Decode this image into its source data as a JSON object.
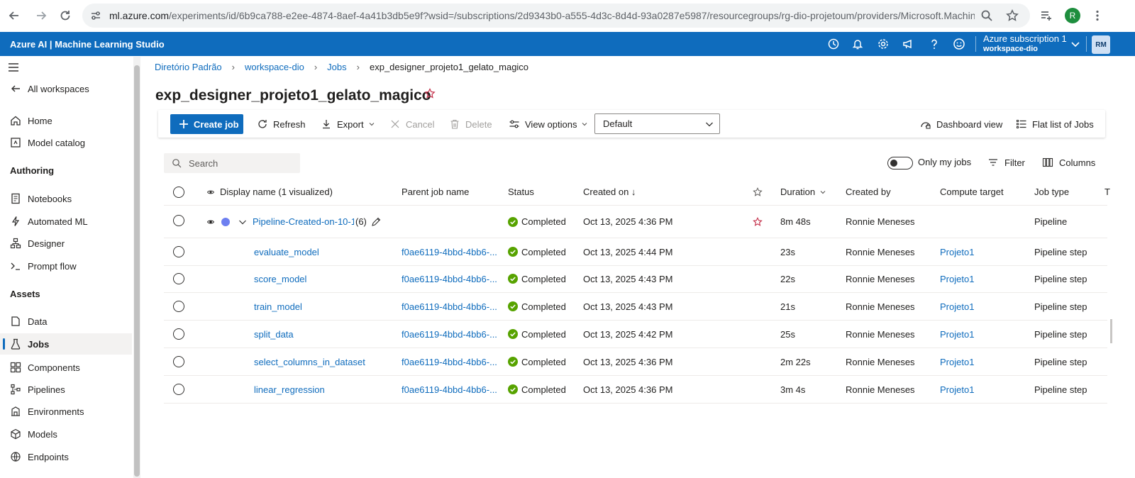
{
  "browser": {
    "url_main": "ml.azure.com",
    "url_rest": "/experiments/id/6b9ca788-e2ee-4874-8aef-4a41b3db5e9f?wsid=/subscriptions/2d9343b0-a555-4d3c-8d4d-93a0287e5987/resourcegroups/rg-dio-projetoum/providers/Microsoft.Machin...",
    "profile_initial": "R"
  },
  "header": {
    "app_title": "Azure AI | Machine Learning Studio",
    "subscription": "Azure subscription 1",
    "workspace": "workspace-dio",
    "avatar_initials": "RM"
  },
  "sidebar": {
    "all_workspaces": "All workspaces",
    "items_top": [
      {
        "label": "Home",
        "icon": "home-icon"
      },
      {
        "label": "Model catalog",
        "icon": "model-catalog-icon"
      }
    ],
    "section_authoring": "Authoring",
    "items_authoring": [
      {
        "label": "Notebooks",
        "icon": "notebook-icon"
      },
      {
        "label": "Automated ML",
        "icon": "automl-icon"
      },
      {
        "label": "Designer",
        "icon": "designer-icon"
      },
      {
        "label": "Prompt flow",
        "icon": "prompt-flow-icon"
      }
    ],
    "section_assets": "Assets",
    "items_assets": [
      {
        "label": "Data",
        "icon": "data-icon"
      },
      {
        "label": "Jobs",
        "icon": "jobs-icon",
        "active": true
      },
      {
        "label": "Components",
        "icon": "components-icon"
      },
      {
        "label": "Pipelines",
        "icon": "pipelines-icon"
      },
      {
        "label": "Environments",
        "icon": "environments-icon"
      },
      {
        "label": "Models",
        "icon": "models-icon"
      },
      {
        "label": "Endpoints",
        "icon": "endpoints-icon"
      }
    ]
  },
  "breadcrumb": [
    "Diretório Padrão",
    "workspace-dio",
    "Jobs",
    "exp_designer_projeto1_gelato_magico"
  ],
  "page_title": "exp_designer_projeto1_gelato_magico",
  "toolbar": {
    "create_job": "Create job",
    "refresh": "Refresh",
    "export": "Export",
    "cancel": "Cancel",
    "delete": "Delete",
    "view_options": "View options",
    "view_select": "Default",
    "dashboard_view": "Dashboard view",
    "flat_list": "Flat list of Jobs"
  },
  "filters": {
    "search_placeholder": "Search",
    "only_my_jobs": "Only my jobs",
    "only_my_jobs_on": false,
    "filter": "Filter",
    "columns": "Columns"
  },
  "table": {
    "headers": {
      "display_name": "Display name (1 visualized)",
      "parent_job": "Parent job name",
      "status": "Status",
      "created_on": "Created on ↓",
      "duration": "Duration",
      "created_by": "Created by",
      "compute": "Compute target",
      "job_type": "Job type",
      "next": "T"
    },
    "parent_row": {
      "name": "Pipeline-Created-on-10-13",
      "child_count": "(6)",
      "status": "Completed",
      "created_on": "Oct 13, 2025 4:36 PM",
      "duration": "8m 48s",
      "created_by": "Ronnie Meneses",
      "compute": "",
      "job_type": "Pipeline"
    },
    "rows": [
      {
        "name": "evaluate_model",
        "parent": "f0ae6119-4bbd-4bb6-...",
        "status": "Completed",
        "created_on": "Oct 13, 2025 4:44 PM",
        "duration": "23s",
        "created_by": "Ronnie Meneses",
        "compute": "Projeto1",
        "job_type": "Pipeline step"
      },
      {
        "name": "score_model",
        "parent": "f0ae6119-4bbd-4bb6-...",
        "status": "Completed",
        "created_on": "Oct 13, 2025 4:43 PM",
        "duration": "22s",
        "created_by": "Ronnie Meneses",
        "compute": "Projeto1",
        "job_type": "Pipeline step"
      },
      {
        "name": "train_model",
        "parent": "f0ae6119-4bbd-4bb6-...",
        "status": "Completed",
        "created_on": "Oct 13, 2025 4:43 PM",
        "duration": "21s",
        "created_by": "Ronnie Meneses",
        "compute": "Projeto1",
        "job_type": "Pipeline step"
      },
      {
        "name": "split_data",
        "parent": "f0ae6119-4bbd-4bb6-...",
        "status": "Completed",
        "created_on": "Oct 13, 2025 4:42 PM",
        "duration": "25s",
        "created_by": "Ronnie Meneses",
        "compute": "Projeto1",
        "job_type": "Pipeline step"
      },
      {
        "name": "select_columns_in_dataset",
        "parent": "f0ae6119-4bbd-4bb6-...",
        "status": "Completed",
        "created_on": "Oct 13, 2025 4:36 PM",
        "duration": "2m 22s",
        "created_by": "Ronnie Meneses",
        "compute": "Projeto1",
        "job_type": "Pipeline step"
      },
      {
        "name": "linear_regression",
        "parent": "f0ae6119-4bbd-4bb6-...",
        "status": "Completed",
        "created_on": "Oct 13, 2025 4:36 PM",
        "duration": "3m 4s",
        "created_by": "Ronnie Meneses",
        "compute": "Projeto1",
        "job_type": "Pipeline step"
      }
    ]
  },
  "colors": {
    "brand": "#0f6cbd",
    "status_success": "#57a300",
    "favorite_star": "#c4314b",
    "visualized_dot": "#6d7ff0"
  }
}
